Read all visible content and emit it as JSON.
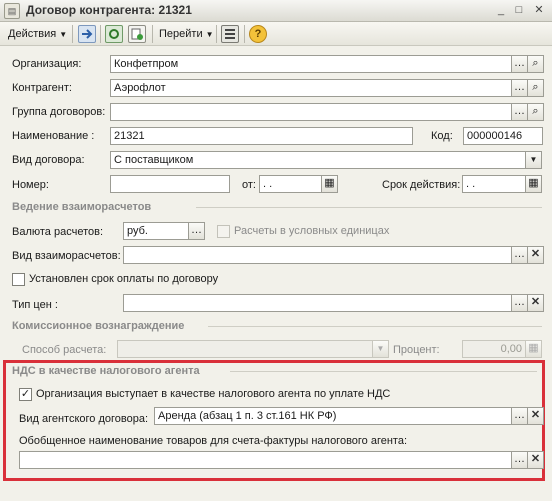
{
  "window": {
    "title": "Договор контрагента: 21321",
    "icon": "document-icon",
    "buttons": [
      "minimize",
      "maximize",
      "close"
    ]
  },
  "toolbar": {
    "actions_label": "Действия",
    "goto_label": "Перейти",
    "icons": [
      "move-icon",
      "refresh-icon",
      "copy-icon",
      "structure-icon",
      "help-icon"
    ]
  },
  "form": {
    "org_label": "Организация:",
    "org_value": "Конфетпром",
    "counterparty_label": "Контрагент:",
    "counterparty_value": "Аэрофлот",
    "group_label": "Группа договоров:",
    "group_value": "",
    "name_label": "Наименование :",
    "name_value": "21321",
    "code_label": "Код:",
    "code_value": "000000146",
    "type_label": "Вид договора:",
    "type_value": "С поставщиком",
    "number_label": "Номер:",
    "number_value": "",
    "from_label": "от:",
    "from_value": " .  .",
    "validity_label": "Срок действия:",
    "validity_value": " .  ."
  },
  "settlements": {
    "section_title": "Ведение взаиморасчетов",
    "currency_label": "Валюта расчетов:",
    "currency_value": "руб.",
    "conditional_units_label": "Расчеты в условных единицах",
    "conditional_units_checked": false,
    "mode_label": "Вид взаиморасчетов:",
    "mode_value": "",
    "payment_term_label": "Установлен срок оплаты по договору",
    "payment_term_checked": false,
    "price_type_label": "Тип цен :",
    "price_type_value": ""
  },
  "commission": {
    "section_title": "Комиссионное вознаграждение",
    "method_label": "Способ расчета:",
    "method_value": "",
    "percent_label": "Процент:",
    "percent_value": "0,00"
  },
  "vat_agent": {
    "section_title": "НДС в качестве налогового агента",
    "acts_as_agent_label": "Организация выступает в качестве налогового агента по уплате НДС",
    "acts_as_agent_checked": true,
    "contract_kind_label": "Вид агентского договора:",
    "contract_kind_value": "Аренда (абзац 1 п. 3 ст.161 НК РФ)",
    "goods_name_label": "Обобщенное наименование товаров для счета-фактуры налогового агента:",
    "goods_name_value": "",
    "highlight_color": "#d9303a"
  }
}
